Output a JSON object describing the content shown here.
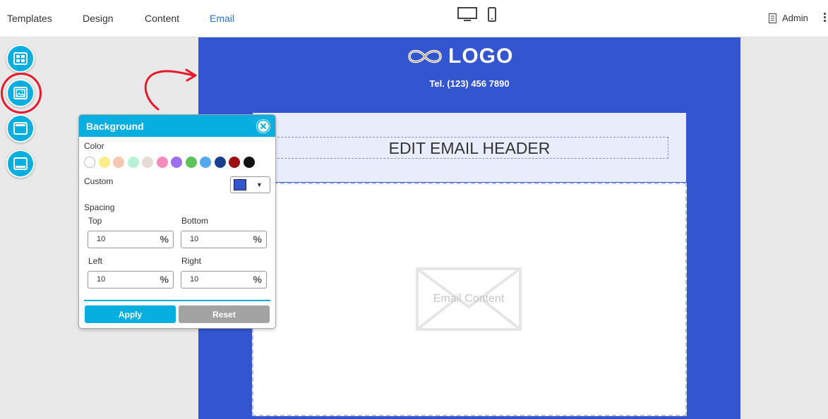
{
  "nav": {
    "tabs": [
      {
        "label": "Templates"
      },
      {
        "label": "Design"
      },
      {
        "label": "Content"
      },
      {
        "label": "Email",
        "active": true
      }
    ],
    "user_label": "Admin"
  },
  "tools": [
    "layout-icon",
    "background-image-icon",
    "header-block-icon",
    "footer-block-icon"
  ],
  "email": {
    "logo_text": "LOGO",
    "tel": "Tel. (123) 456 7890",
    "header_text": "EDIT EMAIL HEADER",
    "content_placeholder": "Email Content",
    "background_color": "#3355cf"
  },
  "panel": {
    "title": "Background",
    "color_label": "Color",
    "swatches": [
      "#ffffff",
      "#fbee8b",
      "#f7c7b2",
      "#b6f3d6",
      "#e6dcd3",
      "#f58bbd",
      "#9d6ef0",
      "#5ec25a",
      "#54a9ee",
      "#1a3f8c",
      "#9c0f12",
      "#111111"
    ],
    "custom_label": "Custom",
    "custom_color": "#3355cf",
    "spacing_label": "Spacing",
    "top_label": "Top",
    "top_value": "10",
    "bottom_label": "Bottom",
    "bottom_value": "10",
    "left_label": "Left",
    "left_value": "10",
    "right_label": "Right",
    "right_value": "10",
    "unit": "%",
    "apply_label": "Apply",
    "reset_label": "Reset"
  }
}
